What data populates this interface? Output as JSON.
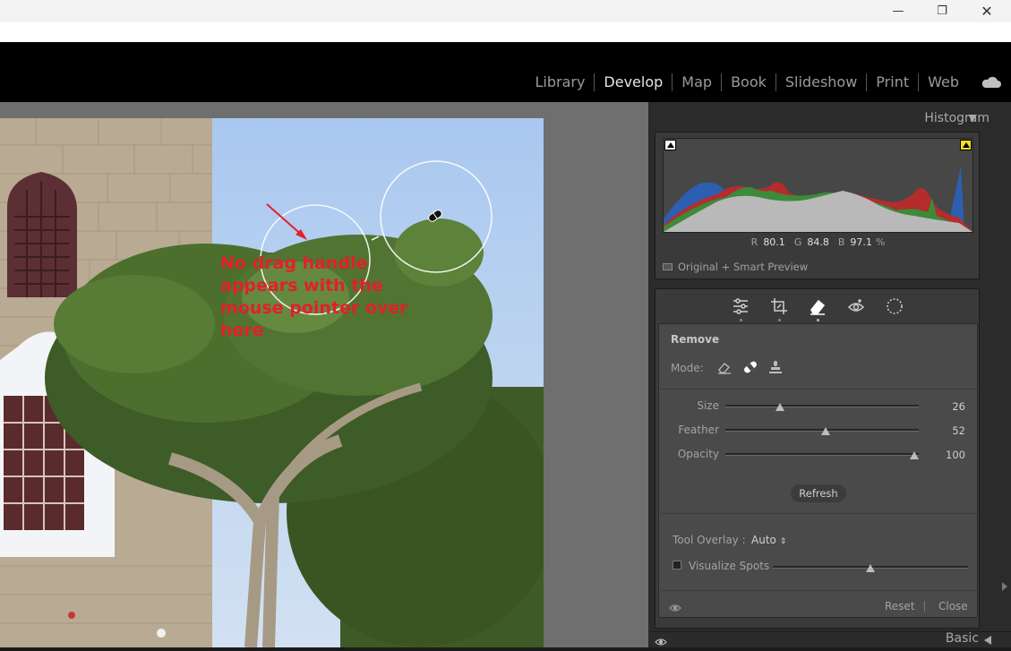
{
  "modules": {
    "items": [
      "Library",
      "Develop",
      "Map",
      "Book",
      "Slideshow",
      "Print",
      "Web"
    ],
    "active": "Develop"
  },
  "annotation": {
    "lines": [
      "No drag handle",
      "appears with the",
      "mouse pointer over",
      "here"
    ]
  },
  "histogram": {
    "title": "Histogram",
    "r_label": "R",
    "r_value": "80.1",
    "g_label": "G",
    "g_value": "84.8",
    "b_label": "B",
    "b_value": "97.1",
    "unit": "%",
    "preview_label": "Original + Smart Preview"
  },
  "tools": {
    "icons": [
      "sliders-icon",
      "crop-icon",
      "eraser-icon",
      "redeye-icon",
      "mask-icon"
    ],
    "active": "eraser-icon"
  },
  "remove": {
    "title": "Remove",
    "mode_label": "Mode:",
    "size_label": "Size",
    "size_value": "26",
    "size_level": 0.27,
    "feather_label": "Feather",
    "feather_value": "52",
    "feather_level": 0.52,
    "opacity_label": "Opacity",
    "opacity_value": "100",
    "opacity_level": 1.0,
    "refresh_label": "Refresh",
    "tool_overlay_label": "Tool Overlay :",
    "tool_overlay_value": "Auto",
    "visualize_label": "Visualize Spots",
    "visualize_level": 0.5,
    "reset_label": "Reset",
    "close_label": "Close"
  },
  "basic": {
    "title": "Basic"
  },
  "colors": {
    "annotation": "#e2202a",
    "panel_bg": "#4a4a4a"
  }
}
